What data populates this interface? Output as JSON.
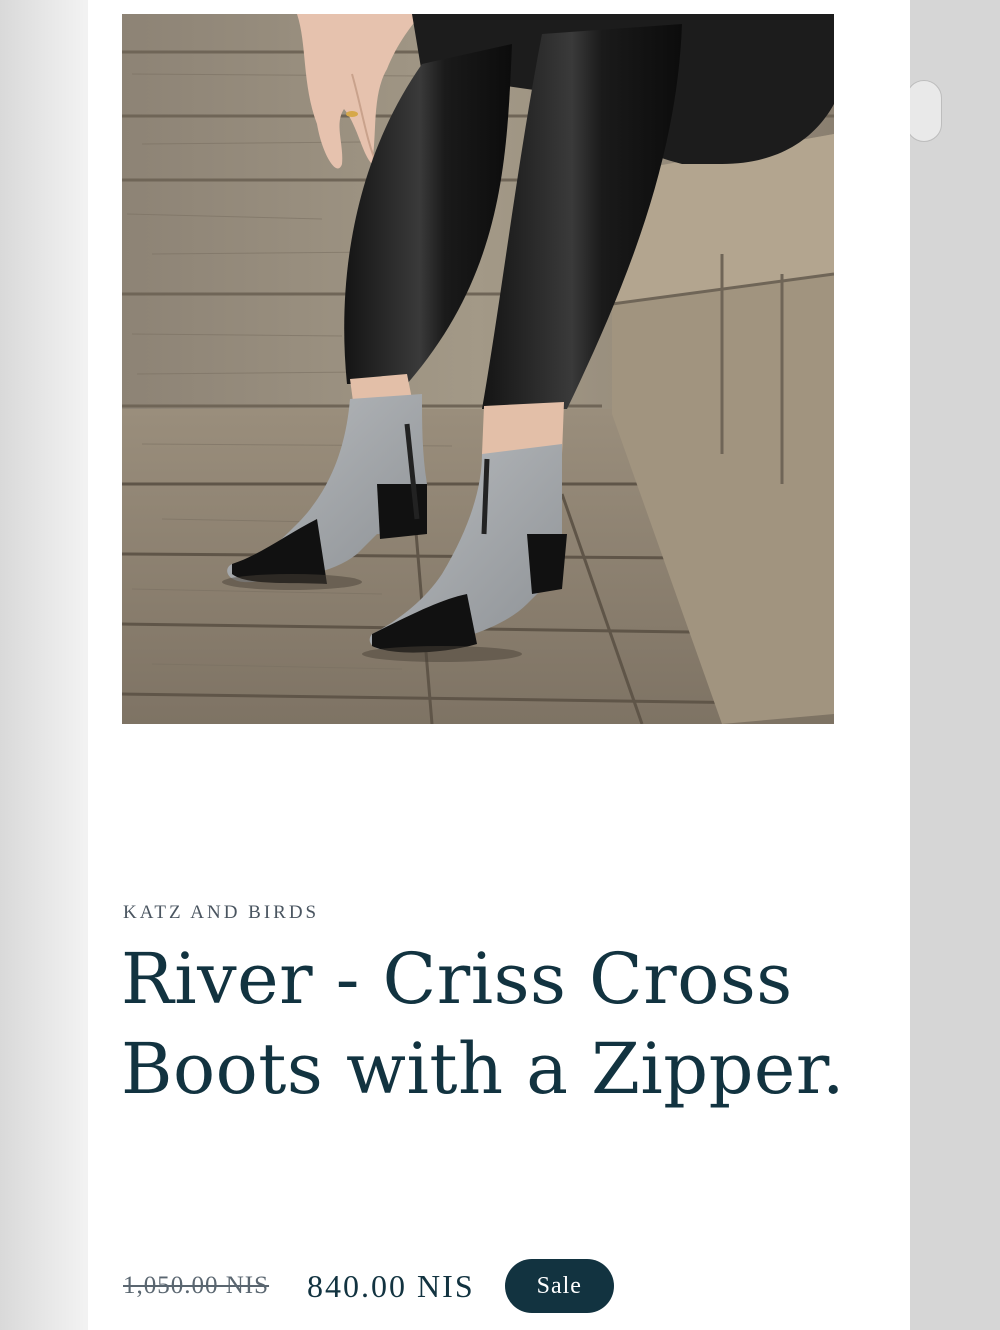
{
  "product": {
    "image_alt": "Woman sitting on wooden steps wearing grey and black criss cross ankle boots with black leather pants",
    "vendor": "KATZ AND BIRDS",
    "title": "River - Criss Cross Boots with a Zipper.",
    "price_compare": "1,050.00 NIS",
    "price_sale": "840.00 NIS",
    "badge": "Sale"
  },
  "colors": {
    "text_primary": "#123340",
    "badge_bg": "#123340",
    "vendor_text": "#4a5560"
  }
}
